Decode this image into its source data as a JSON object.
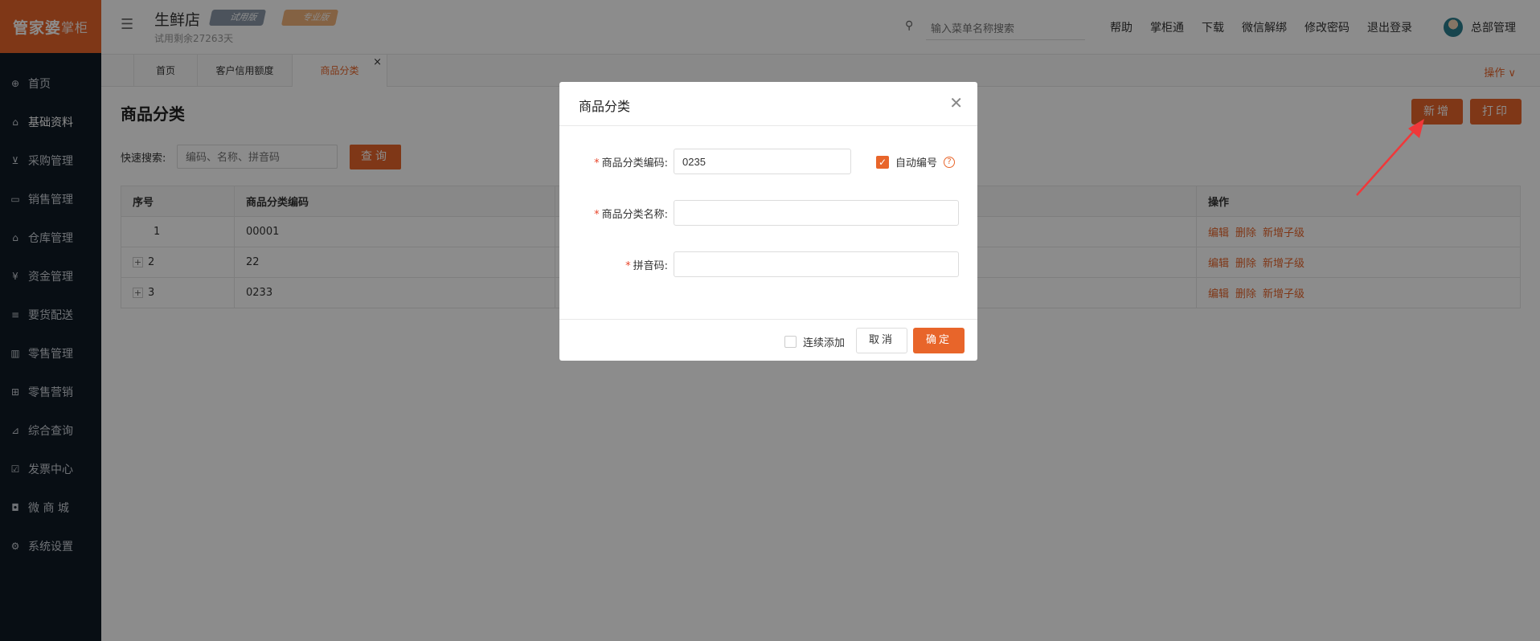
{
  "logo": {
    "text": "管家婆",
    "suffix": "掌柜"
  },
  "sidebar": {
    "items": [
      {
        "label": "首页",
        "icon": "globe-icon",
        "active": false
      },
      {
        "label": "基础资料",
        "icon": "home-icon",
        "active": true
      },
      {
        "label": "采购管理",
        "icon": "cart-icon",
        "active": false
      },
      {
        "label": "销售管理",
        "icon": "sales-icon",
        "active": false
      },
      {
        "label": "仓库管理",
        "icon": "warehouse-icon",
        "active": false
      },
      {
        "label": "资金管理",
        "icon": "money-icon",
        "active": false
      },
      {
        "label": "要货配送",
        "icon": "list-icon",
        "active": false
      },
      {
        "label": "零售管理",
        "icon": "bar-chart-icon",
        "active": false
      },
      {
        "label": "零售营销",
        "icon": "gift-icon",
        "active": false
      },
      {
        "label": "综合查询",
        "icon": "chart-icon",
        "active": false
      },
      {
        "label": "发票中心",
        "icon": "invoice-icon",
        "active": false
      },
      {
        "label": "微 商 城",
        "icon": "bag-icon",
        "active": false
      },
      {
        "label": "系统设置",
        "icon": "gear-icon",
        "active": false
      }
    ]
  },
  "header": {
    "shop_name": "生鲜店",
    "badge_trial": "试用版",
    "badge_pro": "专业版",
    "trial_days": "试用剩余27263天",
    "search_placeholder": "输入菜单名称搜索",
    "links": [
      "帮助",
      "掌柜通",
      "下载",
      "微信解绑",
      "修改密码",
      "退出登录"
    ],
    "user": "总部管理"
  },
  "tabs": {
    "items": [
      "首页",
      "客户信用额度",
      "商品分类"
    ],
    "active": "商品分类",
    "ops_label": "操作 ∨"
  },
  "page": {
    "title": "商品分类",
    "new_button": "新增",
    "print_button": "打印",
    "quick_search_label": "快速搜索:",
    "quick_search_placeholder": "编码、名称、拼音码",
    "query_button": "查询"
  },
  "table": {
    "headers": [
      "序号",
      "商品分类编码",
      "",
      "操作"
    ],
    "rows": [
      {
        "index": "1",
        "code": "00001",
        "expandable": false
      },
      {
        "index": "2",
        "code": "22",
        "expandable": true
      },
      {
        "index": "3",
        "code": "0233",
        "expandable": true
      }
    ],
    "actions": [
      "编辑",
      "删除",
      "新增子级"
    ]
  },
  "modal": {
    "title": "商品分类",
    "code_label": "商品分类编码:",
    "code_value": "0235",
    "auto_label": "自动编号",
    "auto_checked": true,
    "name_label": "商品分类名称:",
    "name_value": "",
    "pinyin_label": "拼音码:",
    "pinyin_value": "",
    "continuous_label": "连续添加",
    "cancel_button": "取消",
    "ok_button": "确定"
  },
  "colors": {
    "accent": "#e8652a",
    "sidebar_bg": "#0f1a26",
    "overlay": "rgba(0,0,0,0.45)",
    "arrow": "#f0383a"
  }
}
